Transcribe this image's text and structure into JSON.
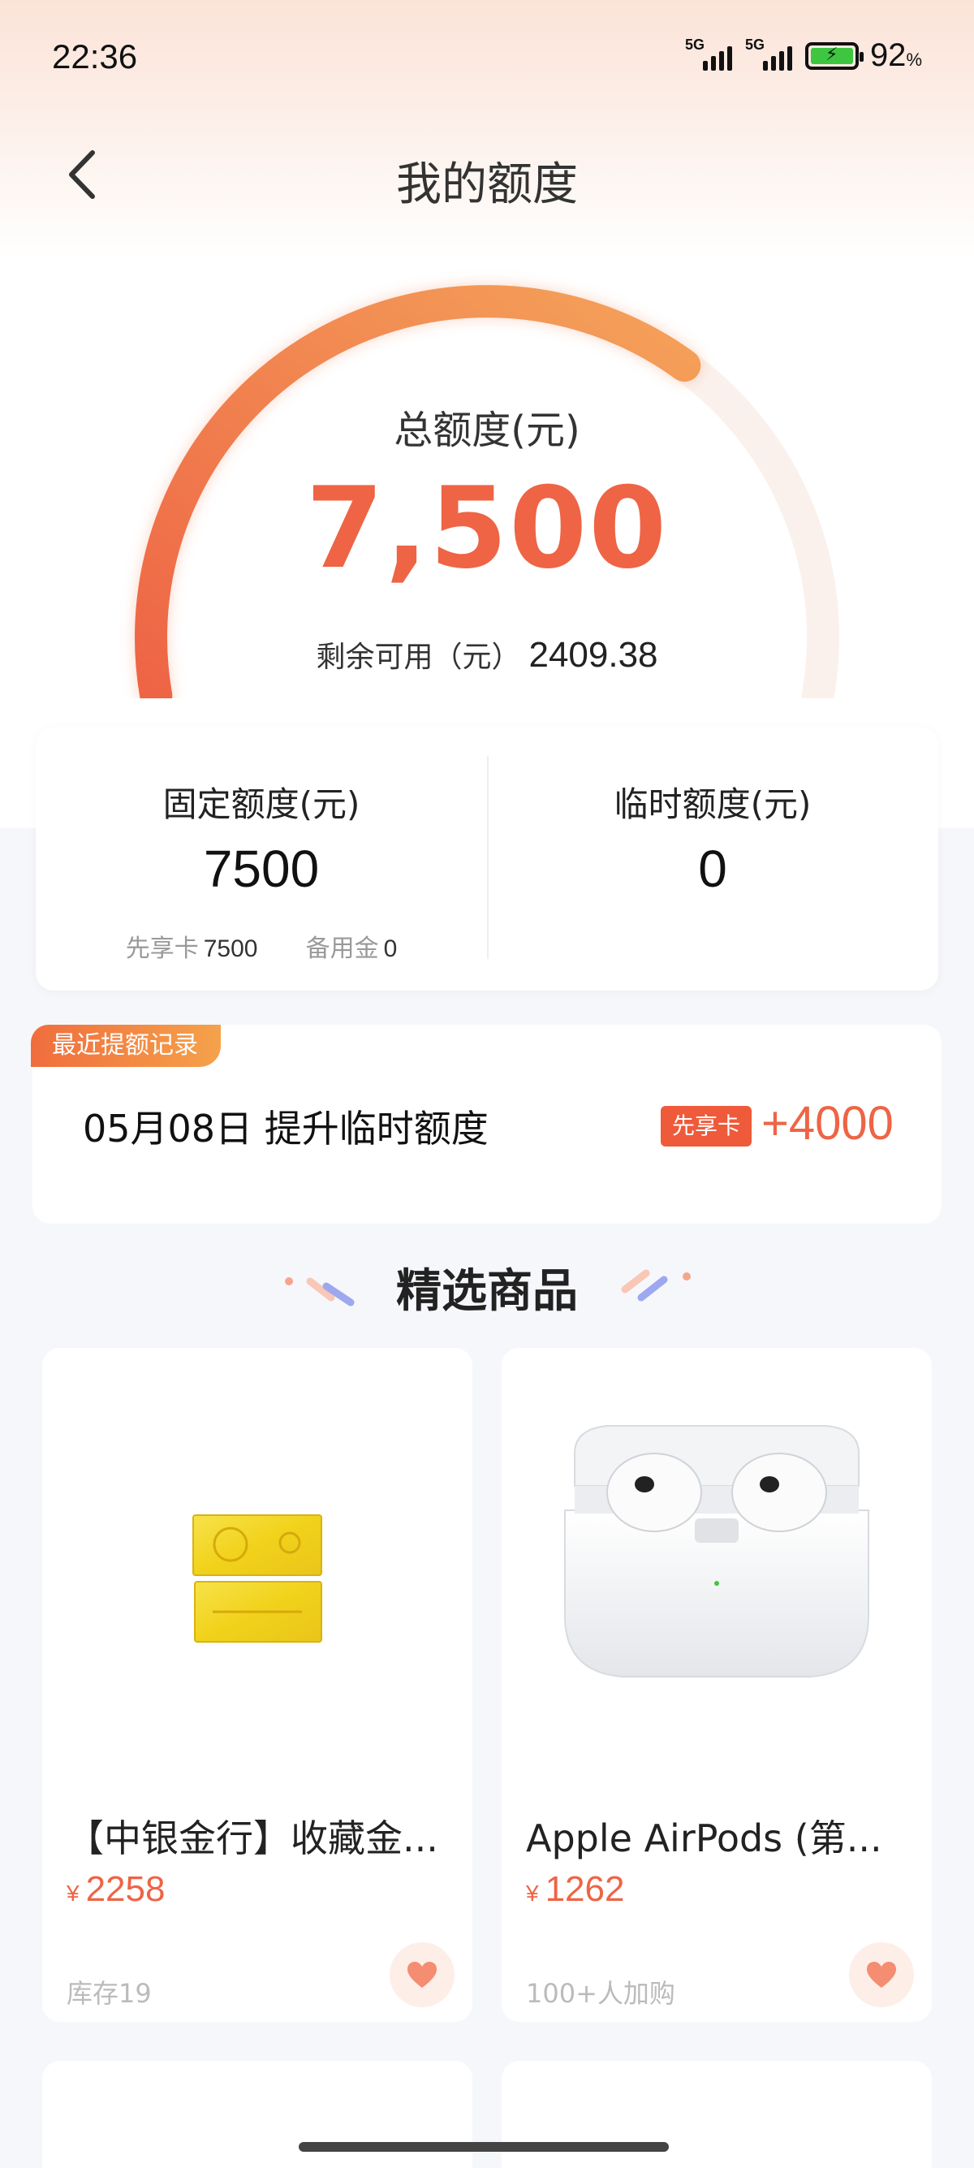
{
  "status_bar": {
    "time": "22:36",
    "battery_percent": "92",
    "battery_unit": "%",
    "network_1": "5G",
    "network_2": "5G"
  },
  "nav": {
    "title": "我的额度"
  },
  "gauge": {
    "title": "总额度(元)",
    "total": "7,500",
    "remaining_label": "剩余可用（元）",
    "remaining_value": "2409.38",
    "used_fraction": 0.68,
    "accent": "#ee6445"
  },
  "quota": {
    "fixed_label": "固定额度(元)",
    "fixed_value": "7500",
    "xianxiang_label": "先享卡",
    "xianxiang_value": "7500",
    "beiyong_label": "备用金",
    "beiyong_value": "0",
    "temp_label": "临时额度(元)",
    "temp_value": "0"
  },
  "record": {
    "tag": "最近提额记录",
    "text": "05月08日 提升临时额度",
    "badge": "先享卡",
    "amount": "+4000"
  },
  "section": {
    "title": "精选商品"
  },
  "products": [
    {
      "name": "【中银金行】收藏金...",
      "currency": "¥",
      "price": "2258",
      "meta": "库存19"
    },
    {
      "name": "Apple AirPods (第...",
      "currency": "¥",
      "price": "1262",
      "meta": "100+人加购"
    }
  ]
}
